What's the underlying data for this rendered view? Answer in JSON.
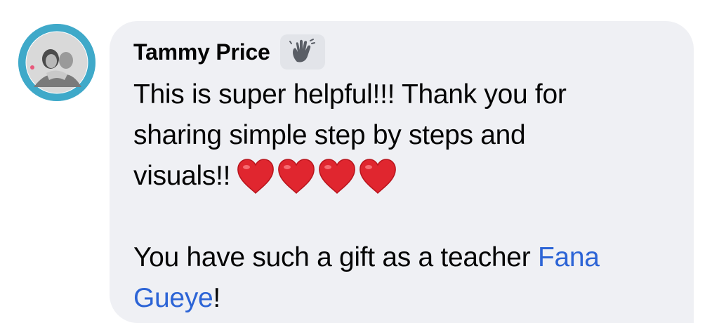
{
  "comment": {
    "author_name": "Tammy Price",
    "badge_icon": "wave-hand-icon",
    "text_line1": "This is super helpful!!!  Thank you for",
    "text_line2": "sharing simple step by steps and",
    "text_line3": "visuals!!",
    "hearts": [
      "red-heart-icon",
      "red-heart-icon",
      "red-heart-icon",
      "red-heart-icon"
    ],
    "text_line4_prefix": "You have such a gift as a teacher ",
    "mention_part1": "Fana",
    "mention_part2": "Gueye",
    "text_suffix": "!"
  },
  "colors": {
    "bubble_bg": "#eff0f4",
    "mention": "#2c64d6",
    "heart": "#e0262f",
    "avatar_ring": "#3fa9c9"
  }
}
